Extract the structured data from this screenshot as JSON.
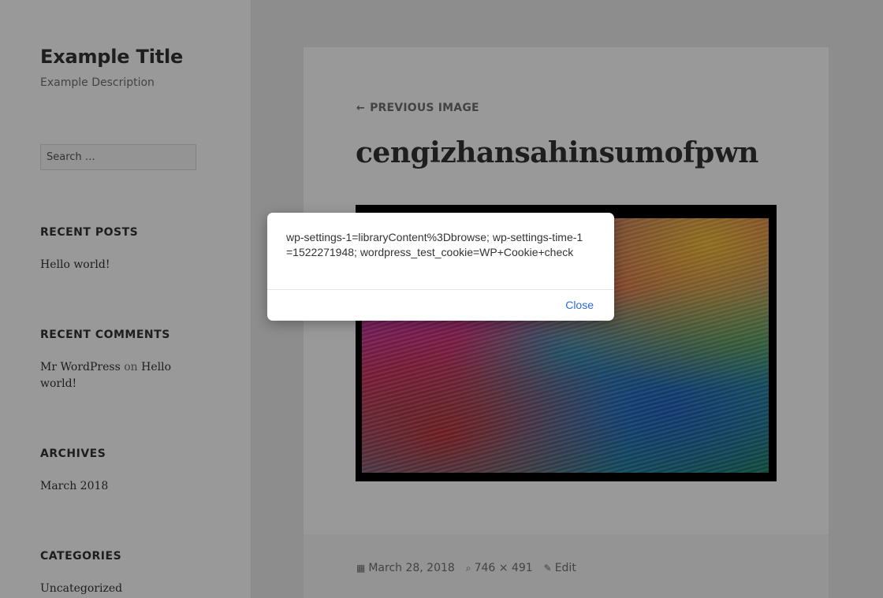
{
  "site": {
    "title": "Example Title",
    "description": "Example Description"
  },
  "search": {
    "placeholder": "Search …"
  },
  "widgets": {
    "recent_posts": {
      "title": "RECENT POSTS",
      "items": [
        "Hello world!"
      ]
    },
    "recent_comments": {
      "title": "RECENT COMMENTS",
      "author": "Mr WordPress",
      "on": "on",
      "post_line1": "Hello",
      "post_line2": "world!"
    },
    "archives": {
      "title": "ARCHIVES",
      "items": [
        "March 2018"
      ]
    },
    "categories": {
      "title": "CATEGORIES",
      "items": [
        "Uncategorized"
      ]
    }
  },
  "post": {
    "prev_label": "PREVIOUS IMAGE",
    "title": "cengizhansahinsumofpwn",
    "meta": {
      "date": "March 28, 2018",
      "dimensions": "746 × 491",
      "edit": "Edit"
    }
  },
  "dialog": {
    "message": "wp-settings-1=libraryContent%3Dbrowse; wp-settings-time-1=1522271948; wordpress_test_cookie=WP+Cookie+check",
    "close_label": "Close"
  },
  "colors": {
    "link": "#2a6bd6",
    "overlay": "rgba(0,0,0,0.4)"
  },
  "icons": [
    "arrow-left-icon",
    "calendar-icon",
    "zoom-icon",
    "pencil-icon"
  ]
}
